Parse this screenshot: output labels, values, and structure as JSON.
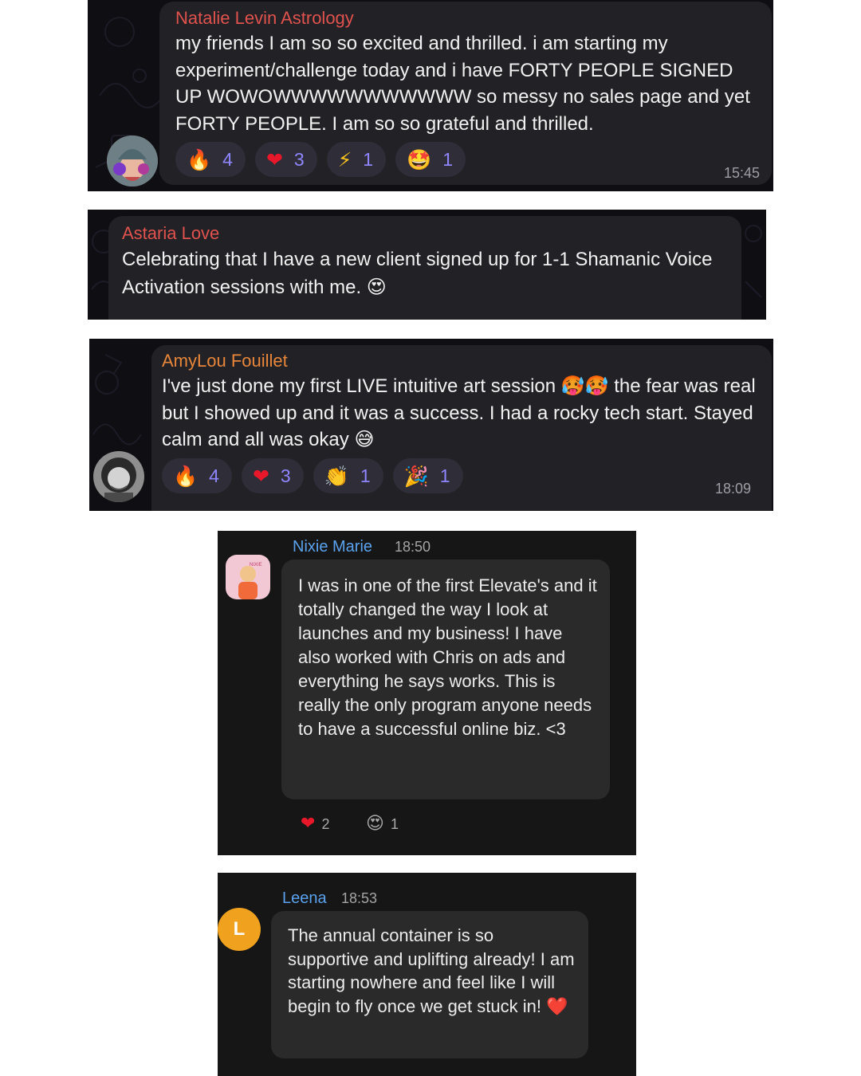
{
  "messages": [
    {
      "sender": "Natalie Levin Astrology",
      "sender_color": "#e0524d",
      "text": "my friends I am so so excited and thrilled.  i am starting my experiment/challenge today and i have FORTY PEOPLE SIGNED UP WOWOWWWWWWWWWWW so messy no sales page and yet FORTY PEOPLE.  I am so so grateful and thrilled.",
      "reactions": [
        {
          "icon": "fire-emoji",
          "glyph": "🔥",
          "count": "4"
        },
        {
          "icon": "heart-emoji",
          "glyph": "❤",
          "count": "3"
        },
        {
          "icon": "lightning-emoji",
          "glyph": "⚡",
          "count": "1"
        },
        {
          "icon": "star-struck-emoji",
          "glyph": "🤩",
          "count": "1"
        }
      ],
      "time": "15:45"
    },
    {
      "sender": "Astaria Love",
      "sender_color": "#e0524d",
      "text": "Celebrating that I have a new client signed up for 1-1 Shamanic Voice Activation sessions with me. 😍"
    },
    {
      "sender": "AmyLou Fouillet",
      "sender_color": "#e8863a",
      "text": "I've just done my first LIVE intuitive art session 🥵🥵 the fear was real but I showed up and it was a success. I had a rocky tech start. Stayed calm and all was okay 😅",
      "reactions": [
        {
          "icon": "fire-emoji",
          "glyph": "🔥",
          "count": "4"
        },
        {
          "icon": "heart-emoji",
          "glyph": "❤",
          "count": "3"
        },
        {
          "icon": "clapping-emoji",
          "glyph": "👏",
          "count": "1"
        },
        {
          "icon": "party-popper-emoji",
          "glyph": "🎉",
          "count": "1"
        }
      ],
      "time": "18:09"
    },
    {
      "sender": "Nixie Marie",
      "time": "18:50",
      "text": "I was in one of the first Elevate's and it totally changed the way I look at launches and my business! I have also worked with Chris on ads and everything he says works. This is really the only program anyone needs to have a successful online biz. <3",
      "reactions": [
        {
          "icon": "heart-emoji",
          "glyph": "❤",
          "count": "2"
        },
        {
          "icon": "heart-eyes-emoji",
          "glyph": "😍",
          "count": "1"
        }
      ]
    },
    {
      "sender": "Leena",
      "avatar_letter": "L",
      "avatar_color": "#f0a21e",
      "time": "18:53",
      "text": "The annual container is so supportive and uplifting already! I am starting nowhere and feel like I will begin to fly once we get stuck in! ❤️"
    }
  ],
  "colors": {
    "reaction_count": "#8f86ff",
    "bubble": "#222126",
    "panel": "#0e0e13",
    "name_blue": "#5aa2ee"
  }
}
